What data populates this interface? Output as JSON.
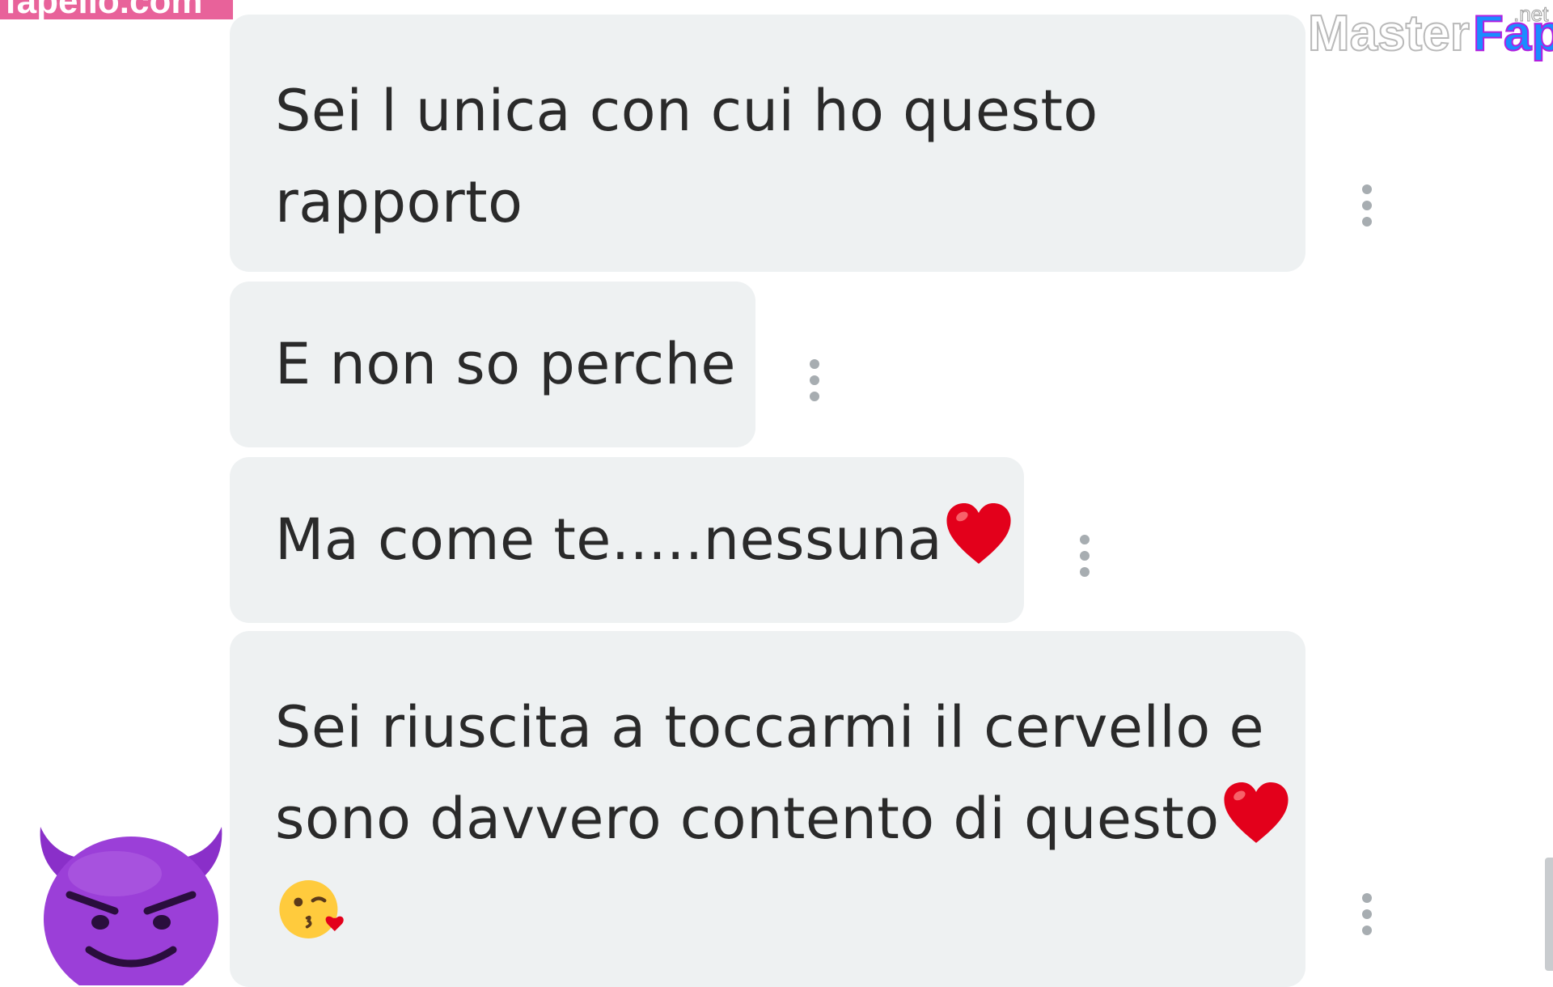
{
  "watermarks": {
    "left_text": "fapello.com",
    "right_brand_a": "Master",
    "right_brand_b": "Fap",
    "right_suffix": ".net"
  },
  "messages": [
    {
      "lines": [
        "Sei l unica con cui ho questo",
        "rapporto"
      ]
    },
    {
      "lines": [
        "E non so perche"
      ]
    },
    {
      "lines": [
        "Ma come te.....nessuna"
      ],
      "trailing_icon": "red-heart-emoji"
    },
    {
      "lines": [
        "Sei riuscita a toccarmi il cervello e",
        "sono davvero contento di questo"
      ],
      "trailing_icon": "red-heart-emoji",
      "extra_icon": "face-blowing-kiss-emoji"
    }
  ],
  "side_icon": "smiling-devil-emoji",
  "colors": {
    "bubble": "#eef1f2",
    "text": "#2a2a2a",
    "dots": "#a7adb1",
    "left_watermark": "#e8629a",
    "right_watermark_blue": "#1a8cff",
    "right_watermark_purple": "#b21fe0",
    "heart": "#e3001b",
    "devil": "#9b3fd8"
  }
}
